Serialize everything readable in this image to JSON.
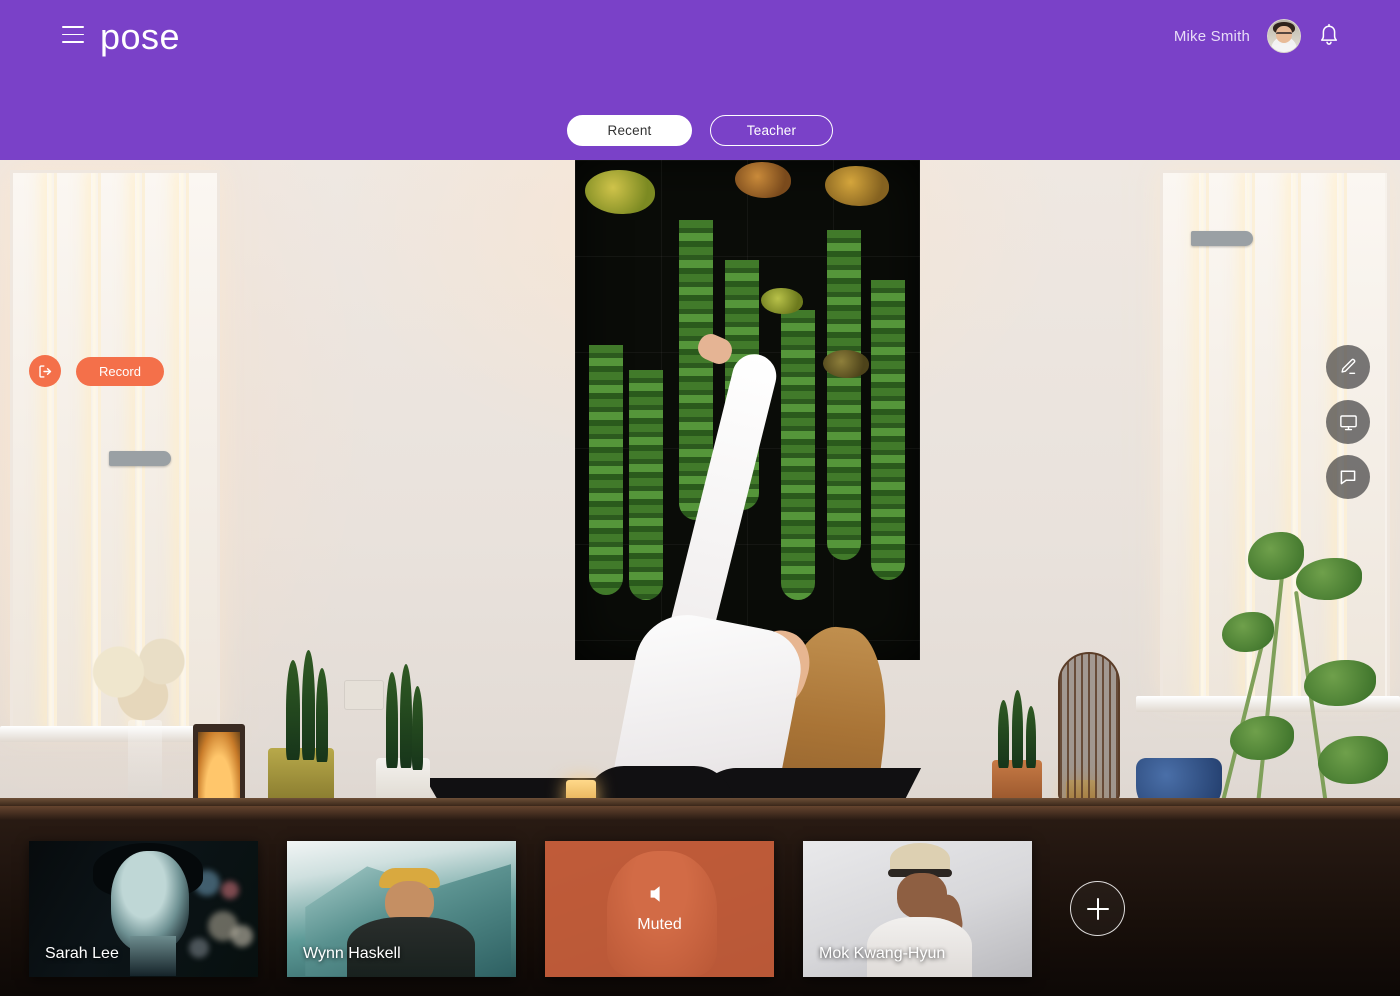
{
  "app": {
    "brand": "pose",
    "accent_purple": "#7a41c8",
    "accent_orange": "#f4704a"
  },
  "header": {
    "menu_icon": "hamburger-menu-icon",
    "logo_text": "pose",
    "user_name": "Mike Smith",
    "avatar_icon": "user-avatar",
    "notification_icon": "bell-icon"
  },
  "tabs": [
    {
      "label": "Recent",
      "active": true
    },
    {
      "label": "Teacher",
      "active": false
    }
  ],
  "stage": {
    "exit_icon": "exit-logout-icon",
    "record_label": "Record",
    "tools": [
      {
        "name": "annotate-tool",
        "icon": "pencil-icon"
      },
      {
        "name": "screen-share-tool",
        "icon": "monitor-icon"
      },
      {
        "name": "chat-tool",
        "icon": "chat-bubble-icon"
      }
    ]
  },
  "participants": [
    {
      "name": "Sarah Lee",
      "muted": false,
      "status": ""
    },
    {
      "name": "Wynn Haskell",
      "muted": false,
      "status": ""
    },
    {
      "name": "",
      "muted": true,
      "status": "Muted",
      "mute_icon": "speaker-muted-icon"
    },
    {
      "name": "Mok Kwang-Hyun",
      "muted": false,
      "status": ""
    }
  ],
  "add_participant": {
    "icon": "plus-icon",
    "label": ""
  }
}
